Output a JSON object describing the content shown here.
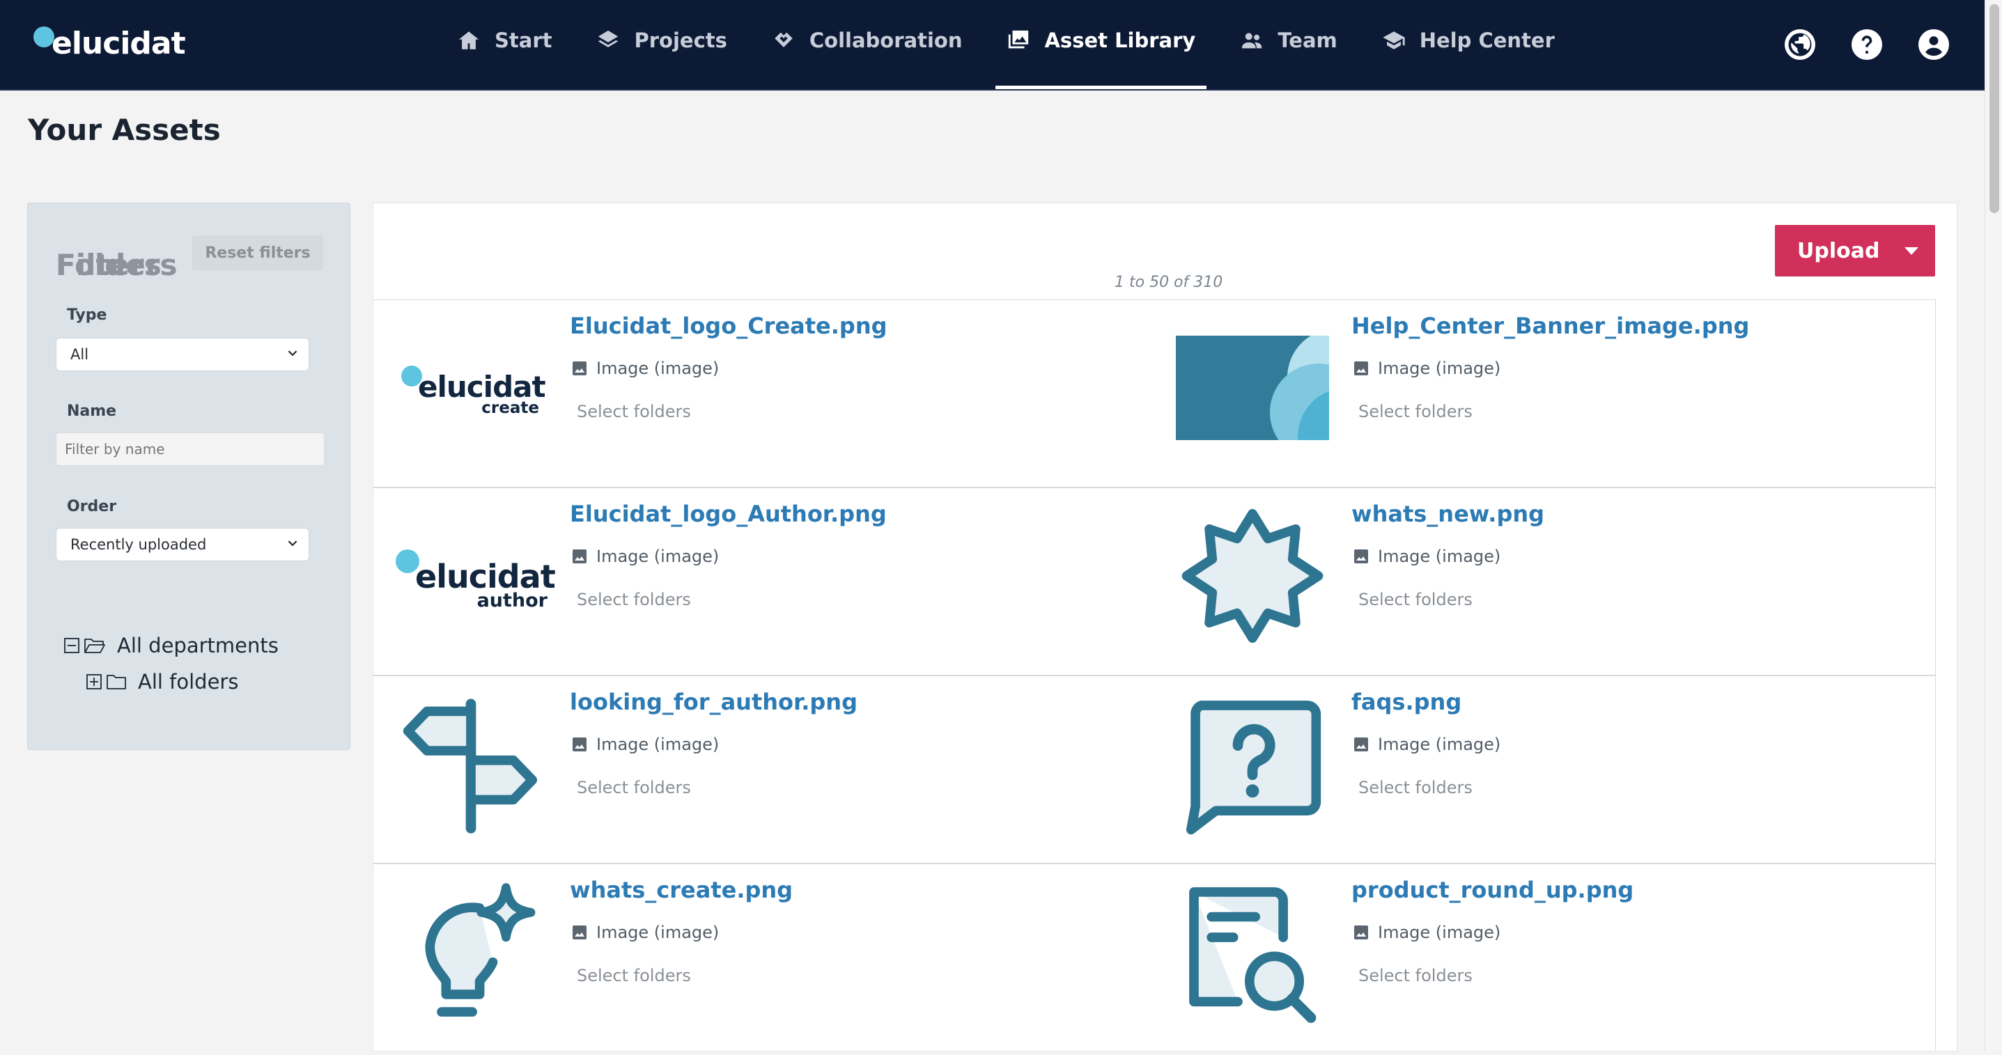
{
  "app": {
    "logo_text": "elucidat"
  },
  "nav": {
    "items": [
      {
        "label": "Start",
        "icon": "home-icon"
      },
      {
        "label": "Projects",
        "icon": "layers-icon"
      },
      {
        "label": "Collaboration",
        "icon": "handshake-icon"
      },
      {
        "label": "Asset Library",
        "icon": "image-library-icon",
        "active": true
      },
      {
        "label": "Team",
        "icon": "people-icon"
      },
      {
        "label": "Help Center",
        "icon": "graduation-cap-icon"
      }
    ],
    "right_icons": [
      "globe-icon",
      "help-icon",
      "account-icon"
    ]
  },
  "page": {
    "title": "Your Assets"
  },
  "filters": {
    "heading": "Filters",
    "reset_label": "Reset filters",
    "type_label": "Type",
    "type_value": "All",
    "name_label": "Name",
    "name_placeholder": "Filter by name",
    "order_label": "Order",
    "order_value": "Recently uploaded",
    "folders_heading": "Folders",
    "tree": [
      {
        "label": "All departments",
        "expanded": true
      },
      {
        "label": "All folders",
        "expanded": false
      }
    ]
  },
  "assets_panel": {
    "upload_label": "Upload",
    "pagination": "1 to 50 of 310",
    "folders_link": "Select folders",
    "items": [
      {
        "name": "Elucidat_logo_Create.png",
        "type": "Image (image)",
        "thumb": "elucidat-create-logo",
        "thumb_word": "elucidat",
        "thumb_sub": "create"
      },
      {
        "name": "Help_Center_Banner_image.png",
        "type": "Image (image)",
        "thumb": "help-center-banner"
      },
      {
        "name": "Elucidat_logo_Author.png",
        "type": "Image (image)",
        "thumb": "elucidat-author-logo",
        "thumb_word": "elucidat",
        "thumb_sub": "author"
      },
      {
        "name": "whats_new.png",
        "type": "Image (image)",
        "thumb": "starburst-badge"
      },
      {
        "name": "looking_for_author.png",
        "type": "Image (image)",
        "thumb": "signpost"
      },
      {
        "name": "faqs.png",
        "type": "Image (image)",
        "thumb": "question-speech-bubble"
      },
      {
        "name": "whats_create.png",
        "type": "Image (image)",
        "thumb": "lightbulb-sparkle"
      },
      {
        "name": "product_round_up.png",
        "type": "Image (image)",
        "thumb": "document-magnifier"
      }
    ]
  },
  "colors": {
    "header_bg": "#0c1a36",
    "accent_link": "#2d7bb5",
    "upload_button": "#d0305a",
    "icon_teal": "#2e7591",
    "logo_dot": "#5ec4e0"
  }
}
